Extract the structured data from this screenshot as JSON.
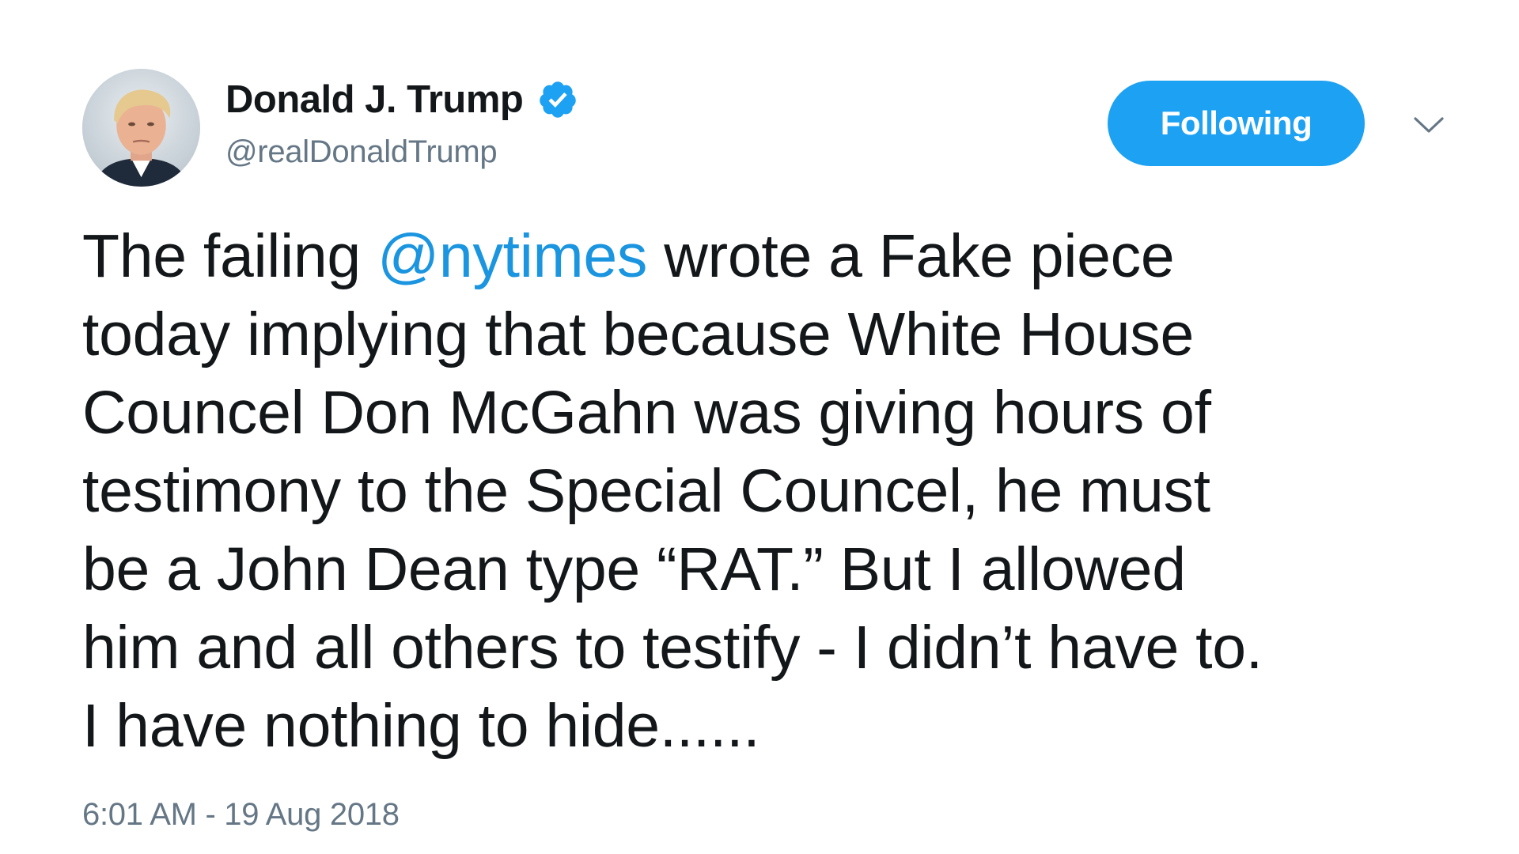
{
  "author": {
    "display_name": "Donald J. Trump",
    "screen_name": "@realDonaldTrump",
    "verified": true,
    "avatar_icon": "avatar-photo"
  },
  "follow_button": {
    "label": "Following"
  },
  "menu": {
    "icon": "chevron-down-icon"
  },
  "tweet": {
    "lines": [
      {
        "before": "The failing ",
        "mention": "@nytimes",
        "after": " wrote a Fake piece"
      },
      {
        "text": "today implying that because White House"
      },
      {
        "text": "Councel Don McGahn was giving hours of"
      },
      {
        "text": "testimony to the Special Councel, he must"
      },
      {
        "text": "be a John Dean type “RAT.” But I allowed"
      },
      {
        "text": "him and all others to testify - I didn’t have to."
      },
      {
        "text": "I have nothing to hide......"
      }
    ]
  },
  "timestamp": "6:01 AM - 19 Aug 2018",
  "colors": {
    "link": "#1b95e0",
    "button_bg": "#1da1f2",
    "secondary_text": "#657786",
    "primary_text": "#14171a"
  }
}
